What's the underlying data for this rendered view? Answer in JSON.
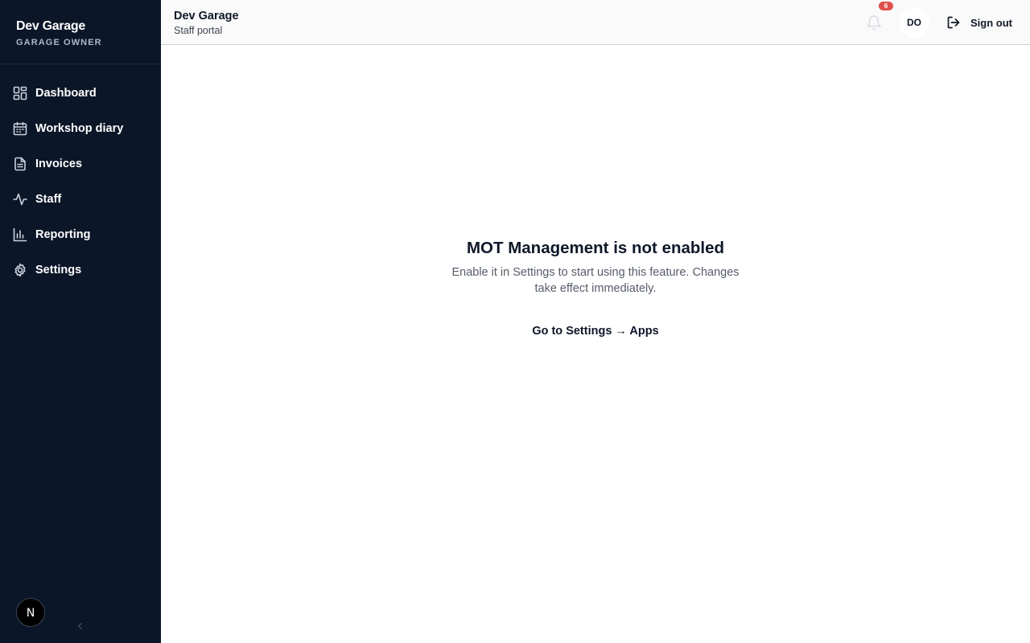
{
  "sidebar": {
    "brand_name": "Dev Garage",
    "brand_role": "GARAGE OWNER",
    "items": [
      {
        "label": "Dashboard",
        "icon": "dashboard-icon"
      },
      {
        "label": "Workshop diary",
        "icon": "calendar-icon"
      },
      {
        "label": "Invoices",
        "icon": "document-icon"
      },
      {
        "label": "Staff",
        "icon": "activity-icon"
      },
      {
        "label": "Reporting",
        "icon": "bar-chart-icon"
      },
      {
        "label": "Settings",
        "icon": "gear-icon"
      }
    ],
    "footer_avatar": "N",
    "collapse_icon": "chevron-left-icon"
  },
  "topbar": {
    "title": "Dev Garage",
    "subtitle": "Staff portal",
    "notification_count": "6",
    "user_initials": "DO",
    "sign_out_label": "Sign out"
  },
  "main": {
    "title": "MOT Management is not enabled",
    "description": "Enable it in Settings to start using this feature. Changes take effect immediately.",
    "link_label": "Go to Settings → Apps"
  },
  "colors": {
    "sidebar_bg": "#0b1628",
    "badge": "#e0504c",
    "topbar_bg": "#fafafa"
  }
}
